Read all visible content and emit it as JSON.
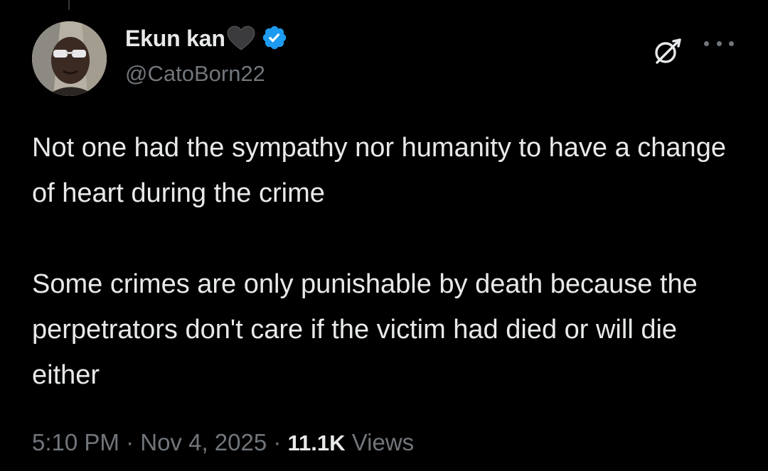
{
  "author": {
    "display_name": "Ekun kan",
    "name_emoji": "black-heart-icon",
    "verified": true,
    "handle": "@CatoBorn22",
    "avatar": "avatar-photo"
  },
  "header_actions": {
    "grok_icon": "grok-icon",
    "more_icon": "more-icon"
  },
  "tweet": {
    "paragraphs": [
      "Not one had the sympathy nor humanity to have a change of heart during the crime",
      "Some crimes are only punishable by death because the perpetrators don't care if the victim had died or will die either"
    ],
    "time": "5:10 PM",
    "separator": " · ",
    "date": "Nov 4, 2025",
    "views_count": "11.1K",
    "views_label": "Views"
  },
  "colors": {
    "background": "#000000",
    "primary_text": "#e7e9ea",
    "secondary_text": "#71767b",
    "verified_blue": "#1d9bf0"
  }
}
